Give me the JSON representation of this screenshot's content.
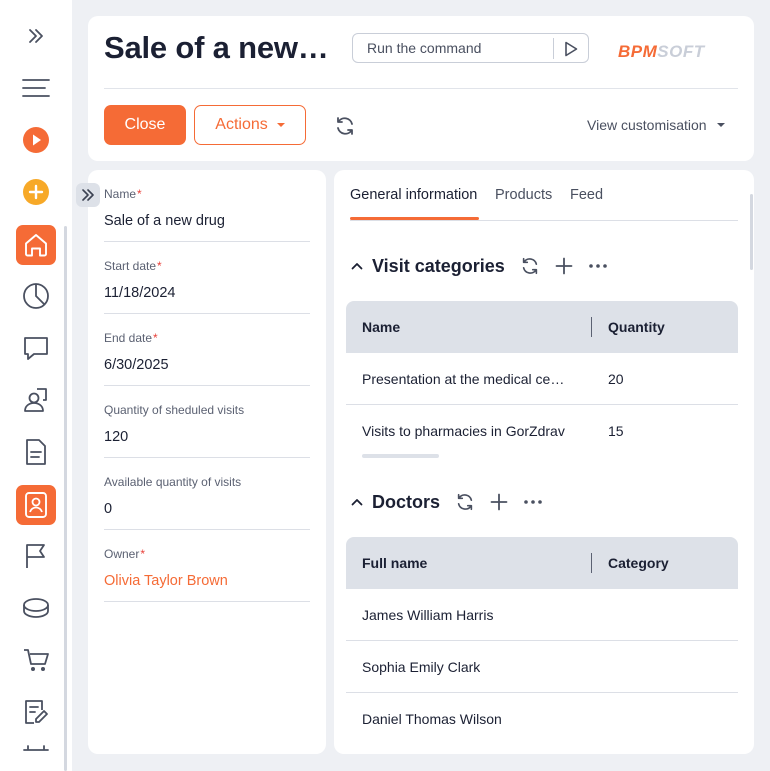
{
  "header": {
    "title": "Sale of a new…",
    "command_placeholder": "Run the command",
    "logo_left": "BPM",
    "logo_right": "SOFT",
    "close_label": "Close",
    "actions_label": "Actions",
    "view_customisation_label": "View customisation"
  },
  "fields": [
    {
      "label": "Name",
      "required": true,
      "value": "Sale of a new drug"
    },
    {
      "label": "Start date",
      "required": true,
      "value": "11/18/2024"
    },
    {
      "label": "End date",
      "required": true,
      "value": "6/30/2025"
    },
    {
      "label": "Quantity of sheduled visits",
      "required": false,
      "value": "120"
    },
    {
      "label": "Available quantity of visits",
      "required": false,
      "value": "0"
    },
    {
      "label": "Owner",
      "required": true,
      "value": "Olivia Taylor Brown"
    }
  ],
  "required_marker": "*",
  "tabs": [
    {
      "label": "General information",
      "active": true
    },
    {
      "label": "Products",
      "active": false
    },
    {
      "label": "Feed",
      "active": false
    }
  ],
  "visit_categories": {
    "title": "Visit categories",
    "columns": [
      "Name",
      "Quantity"
    ],
    "rows": [
      {
        "name": "Presentation at the medical ce…",
        "quantity": "20"
      },
      {
        "name": "Visits to pharmacies in GorZdrav",
        "quantity": "15"
      }
    ]
  },
  "doctors": {
    "title": "Doctors",
    "columns": [
      "Full name",
      "Category"
    ],
    "rows": [
      {
        "full_name": "James William Harris",
        "category": ""
      },
      {
        "full_name": "Sophia Emily Clark",
        "category": ""
      },
      {
        "full_name": "Daniel Thomas Wilson",
        "category": ""
      }
    ]
  },
  "sidebar": {
    "items": [
      {
        "icon": "expand-icon"
      },
      {
        "icon": "menu-icon"
      },
      {
        "icon": "run-process-icon"
      },
      {
        "icon": "add-icon"
      },
      {
        "icon": "home-icon",
        "active": true
      },
      {
        "icon": "dashboard-icon"
      },
      {
        "icon": "chat-icon"
      },
      {
        "icon": "contacts-icon"
      },
      {
        "icon": "document-icon"
      },
      {
        "icon": "contact-card-icon",
        "active": true
      },
      {
        "icon": "flag-icon"
      },
      {
        "icon": "database-icon"
      },
      {
        "icon": "cart-icon"
      },
      {
        "icon": "edit-note-icon"
      }
    ]
  },
  "colors": {
    "accent": "#f56b36",
    "required": "#e8413a",
    "text": "#1b2033",
    "muted": "#5b6172",
    "grid_header": "#dde1e8",
    "background": "#eef0f4"
  }
}
